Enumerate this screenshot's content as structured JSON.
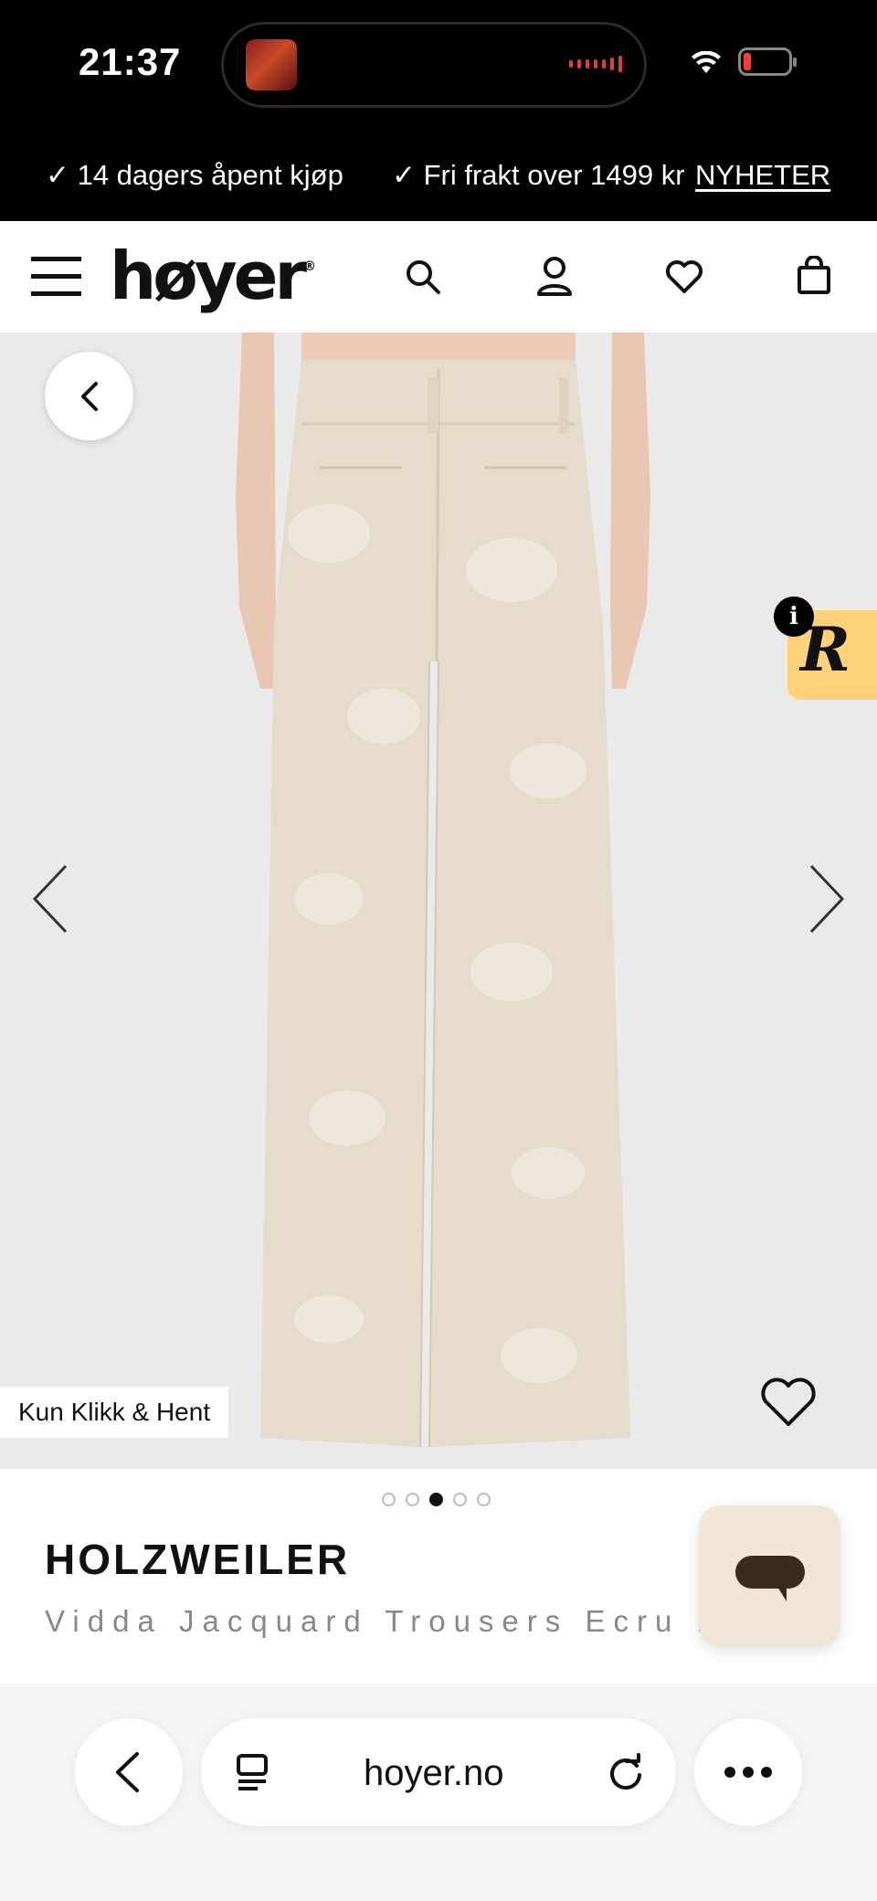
{
  "status_bar": {
    "time": "21:37"
  },
  "promo": {
    "item1": "✓ 14 dagers åpent kjøp",
    "item2": "✓ Fri frakt over 1499 kr",
    "link": "NYHETER"
  },
  "header": {
    "logo": "høyer",
    "logo_mark": "®"
  },
  "gallery": {
    "badge": "Kun Klikk & Hent",
    "info_label": "i",
    "review_logo": "R",
    "current_image": 3,
    "image_count": 5
  },
  "product": {
    "brand": "HOLZWEILER",
    "name": "Vidda Jacquard Trousers Ecru Mi"
  },
  "browser": {
    "url": "hoyer.no"
  },
  "colors": {
    "fabric": "#e5dccb",
    "badge_yellow": "#ffd27a",
    "chat_bg": "#f1e6d8",
    "chat_icon": "#3b2a20"
  }
}
